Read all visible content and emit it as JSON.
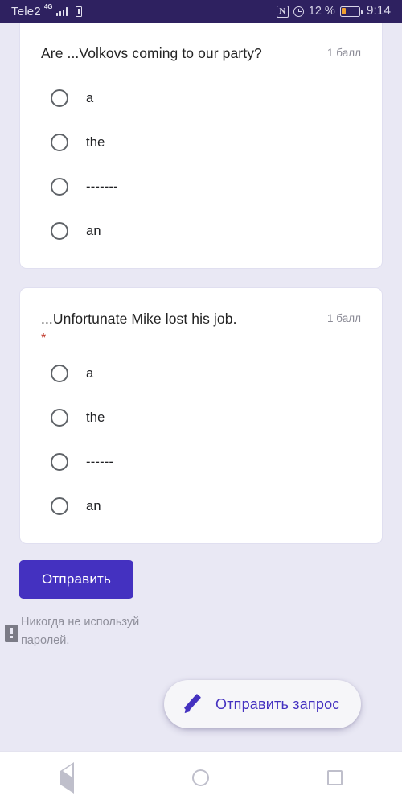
{
  "status_bar": {
    "carrier": "Tele2",
    "network_type": "4G",
    "nfc_icon": "N",
    "battery_percent": "12 %",
    "clock": "9:14",
    "bar_color": "#2e2160",
    "battery_fill_color": "#f0a030"
  },
  "questions": [
    {
      "text": "Are ...Volkovs coming to our party?",
      "points": "1 балл",
      "required": false,
      "options": [
        "a",
        "the",
        "-------",
        "an"
      ]
    },
    {
      "text": "...Unfortunate Mike lost his job.",
      "points": "1 балл",
      "required": true,
      "required_marker": "*",
      "options": [
        "a",
        "the",
        "------",
        "an"
      ]
    }
  ],
  "submit": {
    "label": "Отправить",
    "color": "#4431c0"
  },
  "footer": {
    "note_line1": "Никогда не используй",
    "note_line2": "паролей."
  },
  "fab": {
    "label": "Отправить запрос",
    "icon": "pencil-icon",
    "text_color": "#4431c0"
  },
  "nav_bar": {
    "back": "back-triangle-icon",
    "home": "home-circle-icon",
    "recents": "recents-square-icon"
  }
}
